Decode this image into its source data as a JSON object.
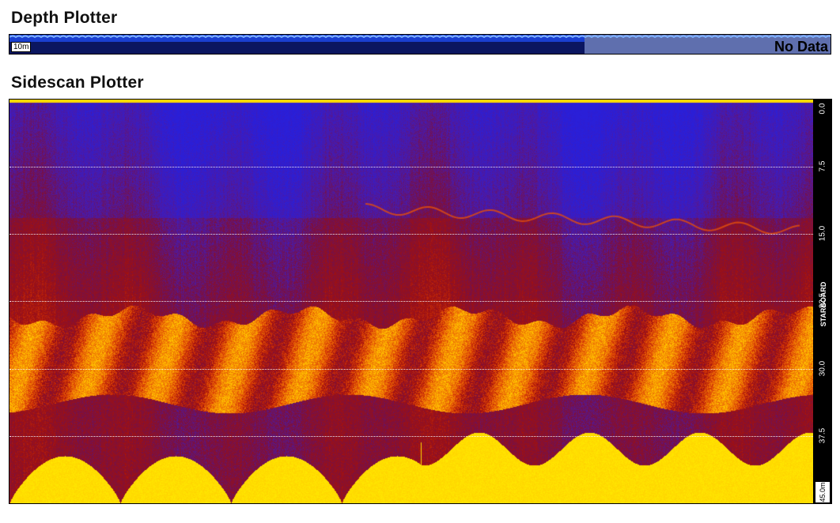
{
  "depth_plotter": {
    "title": "Depth Plotter",
    "scale_label": "10m",
    "status_text": "No Data",
    "data_fraction": 0.7,
    "colors": {
      "water": "#1a3fd0",
      "deep": "#0b1660",
      "no_data": "#5f6fae",
      "wave": "#7fb2ff"
    }
  },
  "sidescan_plotter": {
    "title": "Sidescan Plotter",
    "side_label": "STARBOARD",
    "range_ticks": [
      "0.0",
      "7.5",
      "15.0",
      "22.5",
      "30.0",
      "37.5"
    ],
    "max_range_label": "45.0m",
    "palette": [
      "#2a1fd8",
      "#4a1aa8",
      "#7a1040",
      "#a01010",
      "#d83a05",
      "#f07a05",
      "#ffb400",
      "#ffee00"
    ]
  }
}
